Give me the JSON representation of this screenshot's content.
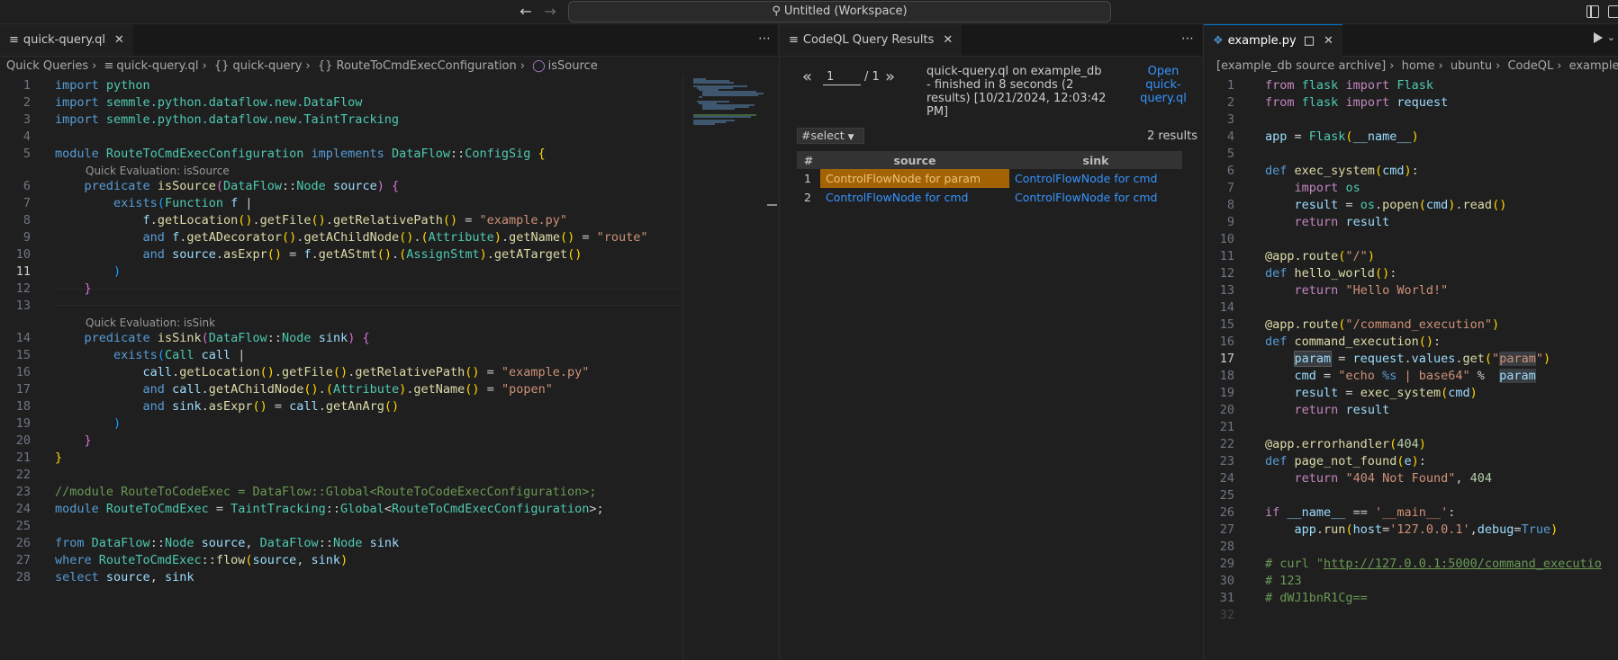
{
  "titlebar": {
    "workspace": "Untitled (Workspace)"
  },
  "left": {
    "tab": "quick-query.ql",
    "breadcrumb": [
      "Quick Queries",
      "quick-query.ql",
      "{} quick-query",
      "{} RouteToCmdExecConfiguration",
      "isSource"
    ],
    "lens": {
      "source": "Quick Evaluation: isSource",
      "sink": "Quick Evaluation: isSink"
    }
  },
  "middle": {
    "tab": "CodeQL Query Results",
    "page_value": "1",
    "page_of": "/ 1",
    "status": "quick-query.ql on example_db - finished in 8 seconds (2 results) [10/21/2024, 12:03:42 PM]",
    "open_link": "Open quick-query.ql",
    "select": "#select",
    "count": "2 results",
    "columns": [
      "#",
      "source",
      "sink"
    ],
    "rows": [
      {
        "idx": "1",
        "source": "ControlFlowNode for param",
        "sink": "ControlFlowNode for cmd"
      },
      {
        "idx": "2",
        "source": "ControlFlowNode for cmd",
        "sink": "ControlFlowNode for cmd"
      }
    ]
  },
  "right": {
    "tab": "example.py",
    "breadcrumb": [
      "[example_db source archive]",
      "home",
      "ubuntu",
      "CodeQL",
      "example"
    ]
  },
  "icons": {
    "back": "arrow-left-icon",
    "forward": "arrow-right-icon",
    "search": "search-icon",
    "run": "play-icon"
  }
}
